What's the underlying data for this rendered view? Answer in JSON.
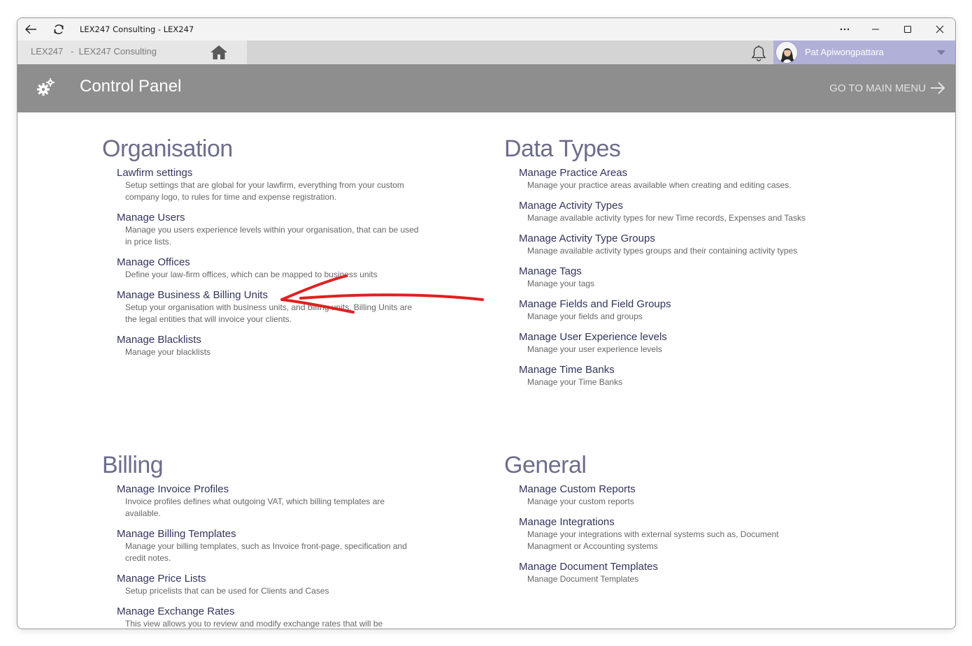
{
  "window": {
    "title": "LEX247 Consulting - LEX247"
  },
  "tabs": {
    "active_label": "LEX247   -  LEX247 Consulting"
  },
  "user": {
    "name": "Pat Apiwongpattara"
  },
  "header": {
    "title": "Control Panel",
    "main_menu_label": "GO TO MAIN MENU"
  },
  "sections": {
    "organisation": {
      "title": "Organisation",
      "items": [
        {
          "title": "Lawfirm settings",
          "desc": "Setup settings that are global for your lawfirm, everything from your custom company logo, to rules for time and expense registration."
        },
        {
          "title": "Manage Users",
          "desc": "Manage you users experience levels within your organisation, that can be used in price lists."
        },
        {
          "title": "Manage Offices",
          "desc": "Define your law-firm offices, which can be mapped to business units"
        },
        {
          "title": "Manage Business & Billing Units",
          "desc": "Setup your organisation with business units, and billing units. Billing Units are the legal entities that will invoice your clients."
        },
        {
          "title": "Manage Blacklists",
          "desc": "Manage your blacklists"
        }
      ]
    },
    "data_types": {
      "title": "Data Types",
      "items": [
        {
          "title": "Manage Practice Areas",
          "desc": "Manage your practice areas available when creating and editing cases."
        },
        {
          "title": "Manage Activity Types",
          "desc": "Manage available activity types for new Time records, Expenses and Tasks"
        },
        {
          "title": "Manage Activity Type Groups",
          "desc": "Manage available activity types groups and their containing activity types"
        },
        {
          "title": "Manage Tags",
          "desc": "Manage your tags"
        },
        {
          "title": "Manage Fields and Field Groups",
          "desc": "Manage your fields and groups"
        },
        {
          "title": "Manage User Experience levels",
          "desc": "Manage your user experience levels"
        },
        {
          "title": "Manage Time Banks",
          "desc": "Manage your Time Banks"
        }
      ]
    },
    "billing": {
      "title": "Billing",
      "items": [
        {
          "title": "Manage Invoice Profiles",
          "desc": "Invoice profiles defines what outgoing VAT, which billing templates are available."
        },
        {
          "title": "Manage Billing Templates",
          "desc": "Manage your billing templates, such as Invoice front-page, specification and credit notes."
        },
        {
          "title": "Manage Price Lists",
          "desc": "Setup pricelists that can be used for Clients and Cases"
        },
        {
          "title": "Manage Exchange Rates",
          "desc": "This view allows you to review and modify exchange rates that will be"
        }
      ]
    },
    "general": {
      "title": "General",
      "items": [
        {
          "title": "Manage Custom Reports",
          "desc": "Manage your custom reports"
        },
        {
          "title": "Manage Integrations",
          "desc": "Manage your integrations with external systems such as, Document Managment or Accounting systems"
        },
        {
          "title": "Manage Document Templates",
          "desc": "Manage Document Templates"
        }
      ]
    }
  },
  "colors": {
    "header_bg": "#8e8e8e",
    "user_bg": "#b0b0d8",
    "section_title": "#6d6d8c",
    "link": "#33335e",
    "annotation_arrow": "#e02020"
  }
}
